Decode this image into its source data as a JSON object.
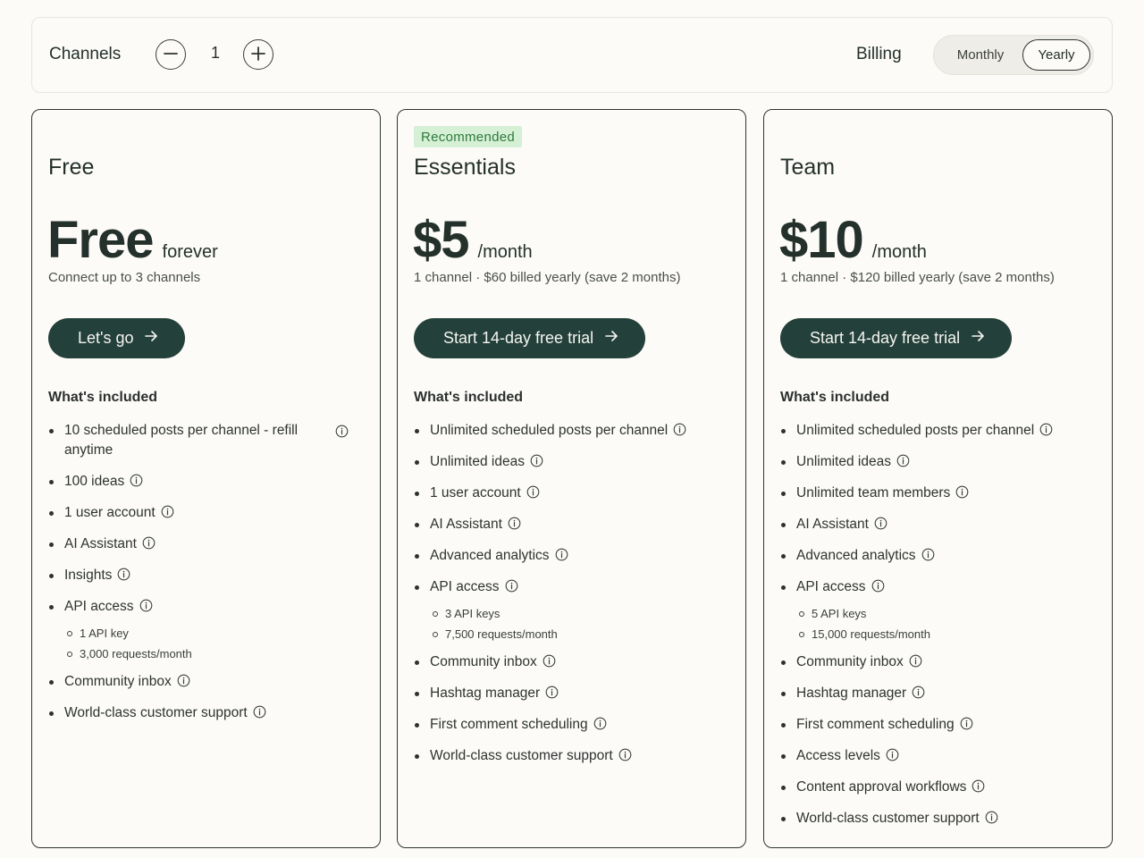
{
  "controls": {
    "channels_label": "Channels",
    "channels_count": "1",
    "billing_label": "Billing",
    "billing_options": [
      "Monthly",
      "Yearly"
    ],
    "billing_selected": "Yearly"
  },
  "plans": [
    {
      "name": "Free",
      "price": "Free",
      "price_unit": "forever",
      "price_note": "Connect up to 3 channels",
      "cta": "Let's go",
      "included_label": "What's included",
      "features": [
        {
          "text": "10 scheduled posts per channel - refill anytime"
        },
        {
          "text": "100 ideas"
        },
        {
          "text": "1 user account"
        },
        {
          "text": "AI Assistant"
        },
        {
          "text": "Insights"
        },
        {
          "text": "API access",
          "sub": [
            "1 API key",
            "3,000 requests/month"
          ]
        },
        {
          "text": "Community inbox"
        },
        {
          "text": "World-class customer support"
        }
      ]
    },
    {
      "badge": "Recommended",
      "name": "Essentials",
      "price": "$5",
      "price_unit": "/month",
      "price_note": "1 channel · $60 billed yearly (save 2 months)",
      "cta": "Start 14-day free trial",
      "included_label": "What's included",
      "features": [
        {
          "text": "Unlimited scheduled posts per channel"
        },
        {
          "text": "Unlimited ideas"
        },
        {
          "text": "1 user account"
        },
        {
          "text": "AI Assistant"
        },
        {
          "text": "Advanced analytics"
        },
        {
          "text": "API access",
          "sub": [
            "3 API keys",
            "7,500 requests/month"
          ]
        },
        {
          "text": "Community inbox"
        },
        {
          "text": "Hashtag manager"
        },
        {
          "text": "First comment scheduling"
        },
        {
          "text": "World-class customer support"
        }
      ]
    },
    {
      "name": "Team",
      "price": "$10",
      "price_unit": "/month",
      "price_note": "1 channel · $120 billed yearly (save 2 months)",
      "cta": "Start 14-day free trial",
      "included_label": "What's included",
      "features": [
        {
          "text": "Unlimited scheduled posts per channel"
        },
        {
          "text": "Unlimited ideas"
        },
        {
          "text": "Unlimited team members"
        },
        {
          "text": "AI Assistant"
        },
        {
          "text": "Advanced analytics"
        },
        {
          "text": "API access",
          "sub": [
            "5 API keys",
            "15,000 requests/month"
          ]
        },
        {
          "text": "Community inbox"
        },
        {
          "text": "Hashtag manager"
        },
        {
          "text": "First comment scheduling"
        },
        {
          "text": "Access levels"
        },
        {
          "text": "Content approval workflows"
        },
        {
          "text": "World-class customer support"
        }
      ]
    }
  ],
  "colors": {
    "background": "#fcfbf8",
    "primary_button": "#24403a",
    "badge_bg": "#d6f0d6",
    "badge_text": "#2e7a3c",
    "text": "#24302b"
  },
  "icons": {
    "decrease": "minus-icon",
    "increase": "plus-icon",
    "cta": "arrow-right-icon",
    "feature_info": "info-icon"
  }
}
